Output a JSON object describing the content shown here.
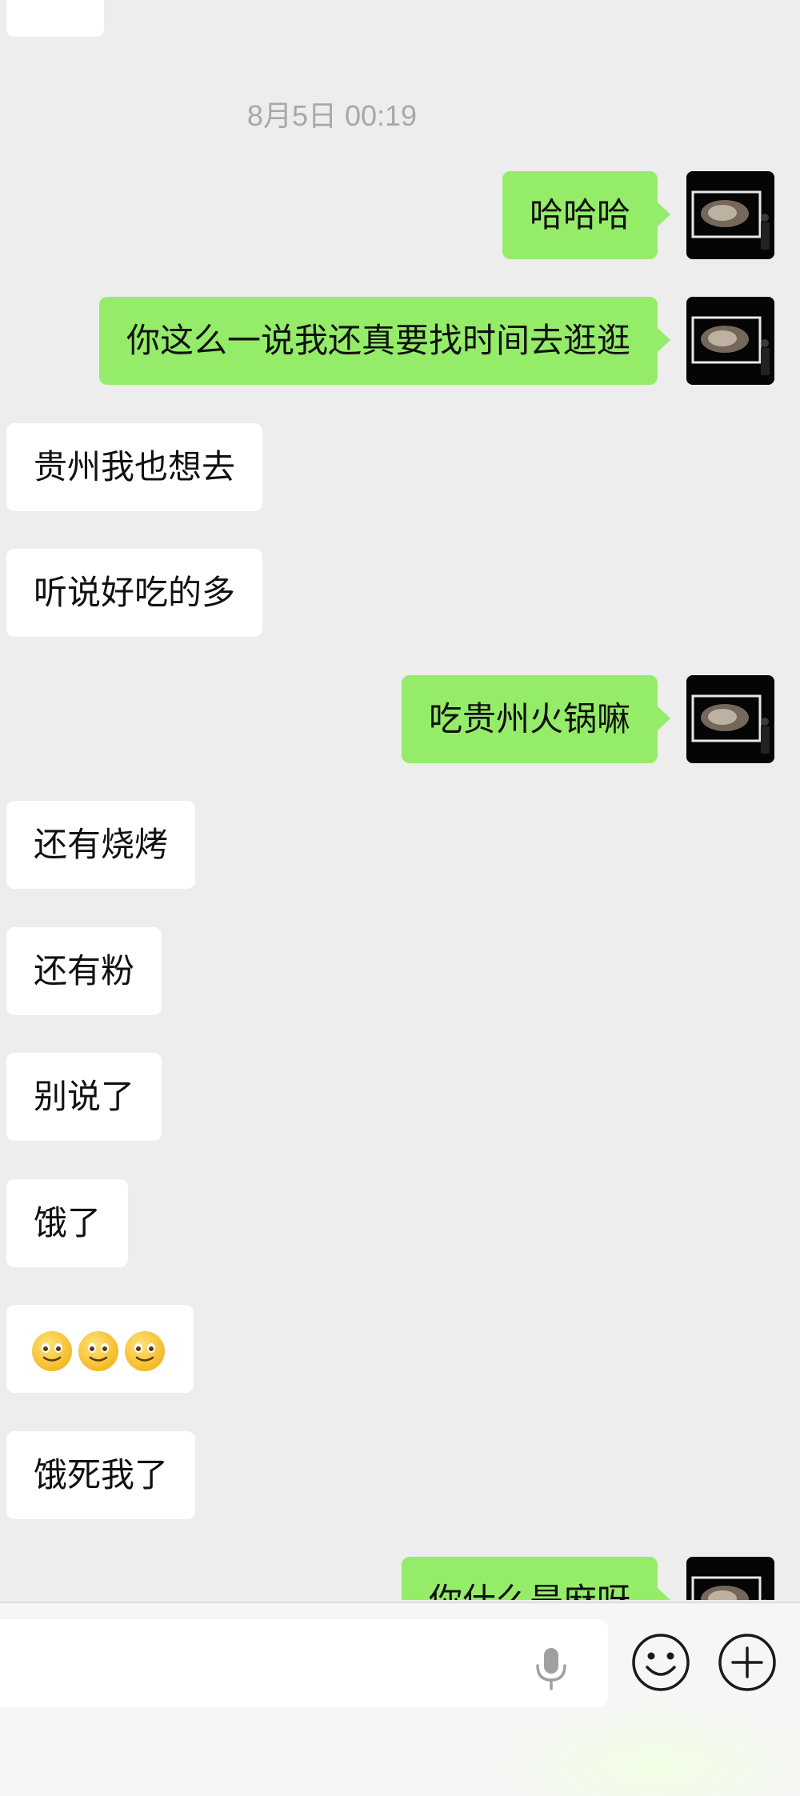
{
  "chat": {
    "timestamp": "8月5日 00:19",
    "messages": [
      {
        "side": "out",
        "text": "哈哈哈"
      },
      {
        "side": "out",
        "text": "你这么一说我还真要找时间去逛逛"
      },
      {
        "side": "in",
        "text": "贵州我也想去"
      },
      {
        "side": "in",
        "text": "听说好吃的多"
      },
      {
        "side": "out",
        "text": "吃贵州火锅嘛"
      },
      {
        "side": "in",
        "text": "还有烧烤"
      },
      {
        "side": "in",
        "text": "还有粉"
      },
      {
        "side": "in",
        "text": "别说了"
      },
      {
        "side": "in",
        "text": "饿了"
      },
      {
        "side": "in",
        "text": "",
        "emoji": [
          "smiley-face-icon",
          "smiley-face-icon",
          "smiley-face-icon"
        ]
      },
      {
        "side": "in",
        "text": "饿死我了"
      },
      {
        "side": "out",
        "text": "你什么是麻呀"
      }
    ]
  },
  "input_bar": {
    "input_value": "",
    "icons": [
      "microphone-icon",
      "emoji-icon",
      "plus-icon"
    ]
  },
  "colors": {
    "background": "#ededed",
    "outgoing_bubble": "#95ec69",
    "incoming_bubble": "#ffffff",
    "timestamp_text": "#a8a8a8"
  }
}
